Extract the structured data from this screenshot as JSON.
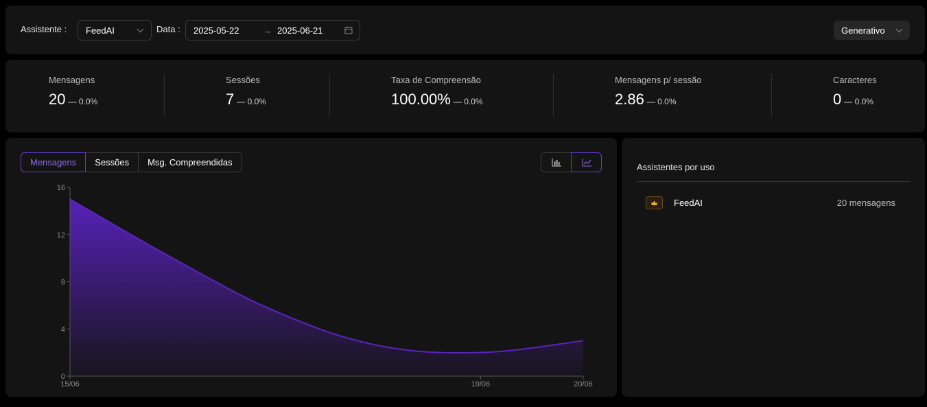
{
  "filters": {
    "assistant_label": "Assistente :",
    "assistant_value": "FeedAI",
    "date_label": "Data :",
    "date_start": "2025-05-22",
    "date_arrow": "→",
    "date_end": "2025-06-21",
    "mode_value": "Generativo"
  },
  "stats": [
    {
      "title": "Mensagens",
      "value": "20",
      "delta": "— 0.0%"
    },
    {
      "title": "Sessões",
      "value": "7",
      "delta": "— 0.0%"
    },
    {
      "title": "Taxa de Compreensão",
      "value": "100.00%",
      "delta": "— 0.0%"
    },
    {
      "title": "Mensagens p/ sessão",
      "value": "2.86",
      "delta": "— 0.0%"
    },
    {
      "title": "Caracteres",
      "value": "0",
      "delta": "— 0.0%"
    }
  ],
  "chart_tabs": [
    "Mensagens",
    "Sessões",
    "Msg. Compreendidas"
  ],
  "active_tab": "Mensagens",
  "chart_toggle_active": "line",
  "colors": {
    "accent": "#6b3ad6",
    "line": "#5b22c2",
    "panel": "#141414"
  },
  "chart_data": {
    "type": "area",
    "x": [
      "15/06",
      "16/06",
      "17/06",
      "18/06",
      "19/06",
      "20/06"
    ],
    "y": [
      15,
      10,
      5.5,
      2.6,
      2,
      3
    ],
    "xticks": [
      "15/06",
      "19/06",
      "20/06"
    ],
    "yticks": [
      "0",
      "4",
      "8",
      "12",
      "16"
    ],
    "ylim": [
      0,
      16
    ],
    "grid": false
  },
  "usage": {
    "title": "Assistentes por uso",
    "items": [
      {
        "icon": "crown-icon",
        "name": "FeedAI",
        "count": "20 mensagens"
      }
    ]
  }
}
